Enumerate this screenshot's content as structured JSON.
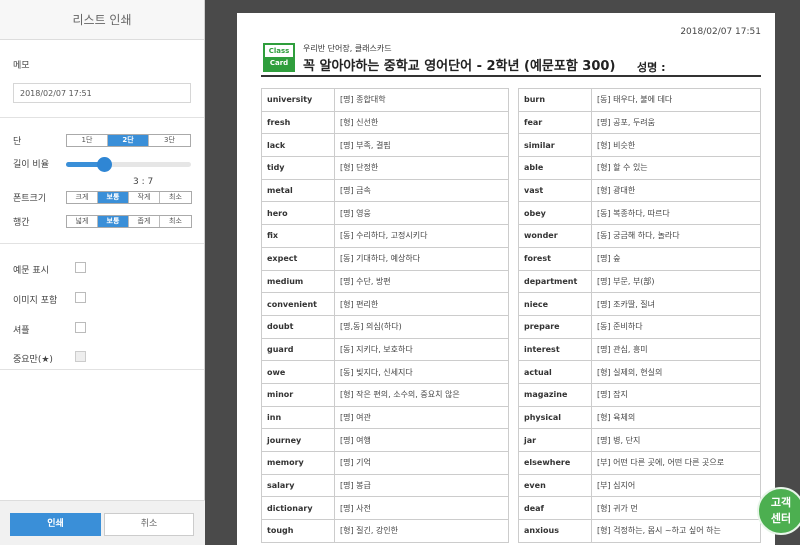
{
  "panel": {
    "title": "리스트 인쇄",
    "memo_label": "메모",
    "memo_value": "2018/02/07 17:51",
    "columns": {
      "label": "단",
      "options": [
        "1단",
        "2단",
        "3단"
      ],
      "selected": 1
    },
    "ratio": {
      "label": "길이 비율",
      "value_text": "3 : 7",
      "fraction": 0.3
    },
    "font_size": {
      "label": "폰트크기",
      "options": [
        "크게",
        "보통",
        "작게",
        "최소"
      ],
      "selected": 1
    },
    "line_spacing": {
      "label": "행간",
      "options": [
        "넓게",
        "보통",
        "좁게",
        "최소"
      ],
      "selected": 1
    },
    "checks": [
      {
        "label": "예문 표시",
        "checked": false,
        "disabled": false
      },
      {
        "label": "이미지 포함",
        "checked": false,
        "disabled": false
      },
      {
        "label": "셔플",
        "checked": false,
        "disabled": false
      },
      {
        "label": "중요만(★)",
        "checked": false,
        "disabled": true
      }
    ],
    "print_label": "인쇄",
    "cancel_label": "취소"
  },
  "paper": {
    "date": "2018/02/07 17:51",
    "logo_top": "Class",
    "logo_bottom": "Card",
    "subtitle": "우리반 단어장, 클래스카드",
    "title": "꼭 알아야하는 중학교 영어단어 - 2학년 (예문포함 300)",
    "name_label": "성명 :"
  },
  "words_left": [
    [
      "university",
      "[명] 종합대학"
    ],
    [
      "fresh",
      "[형] 신선한"
    ],
    [
      "lack",
      "[명] 부족, 결핍"
    ],
    [
      "tidy",
      "[형] 단정한"
    ],
    [
      "metal",
      "[명] 금속"
    ],
    [
      "hero",
      "[명] 영웅"
    ],
    [
      "fix",
      "[동] 수리하다, 고정시키다"
    ],
    [
      "expect",
      "[동] 기대하다, 예상하다"
    ],
    [
      "medium",
      "[명] 수단, 방편"
    ],
    [
      "convenient",
      "[형] 편리한"
    ],
    [
      "doubt",
      "[명,동] 의심(하다)"
    ],
    [
      "guard",
      "[동] 지키다, 보호하다"
    ],
    [
      "owe",
      "[동] 빚지다, 신세지다"
    ],
    [
      "minor",
      "[형] 작은 편의, 소수의, 중요치 않은"
    ],
    [
      "inn",
      "[명] 여관"
    ],
    [
      "journey",
      "[명] 여행"
    ],
    [
      "memory",
      "[명] 기억"
    ],
    [
      "salary",
      "[명] 봉급"
    ],
    [
      "dictionary",
      "[명] 사전"
    ],
    [
      "tough",
      "[형] 질긴, 강인한"
    ]
  ],
  "words_right": [
    [
      "burn",
      "[동] 태우다, 불에 데다"
    ],
    [
      "fear",
      "[명] 공포, 두려움"
    ],
    [
      "similar",
      "[형] 비슷한"
    ],
    [
      "able",
      "[형] 할 수 있는"
    ],
    [
      "vast",
      "[형] 광대한"
    ],
    [
      "obey",
      "[동] 복종하다, 따르다"
    ],
    [
      "wonder",
      "[동] 궁금해 하다, 놀라다"
    ],
    [
      "forest",
      "[명] 숲"
    ],
    [
      "department",
      "[명] 부문, 부(部)"
    ],
    [
      "niece",
      "[명] 조카딸, 질녀"
    ],
    [
      "prepare",
      "[동] 준비하다"
    ],
    [
      "interest",
      "[명] 관심, 흥미"
    ],
    [
      "actual",
      "[형] 실제의, 현실의"
    ],
    [
      "magazine",
      "[명] 잡지"
    ],
    [
      "physical",
      "[형] 육체의"
    ],
    [
      "jar",
      "[명] 병, 단지"
    ],
    [
      "elsewhere",
      "[부] 어떤 다른 곳에, 어떤 다른 곳으로"
    ],
    [
      "even",
      "[부] 심지어"
    ],
    [
      "deaf",
      "[형] 귀가 먼"
    ],
    [
      "anxious",
      "[형] 걱정하는, 몹시 ~하고 싶어 하는"
    ]
  ],
  "support": {
    "line1": "고객",
    "line2": "센터"
  },
  "colors": {
    "accent": "#3a8fd8",
    "brand_green": "#2f9e3c",
    "support_green": "#4caf50",
    "backdrop": "#4a4a4a"
  }
}
